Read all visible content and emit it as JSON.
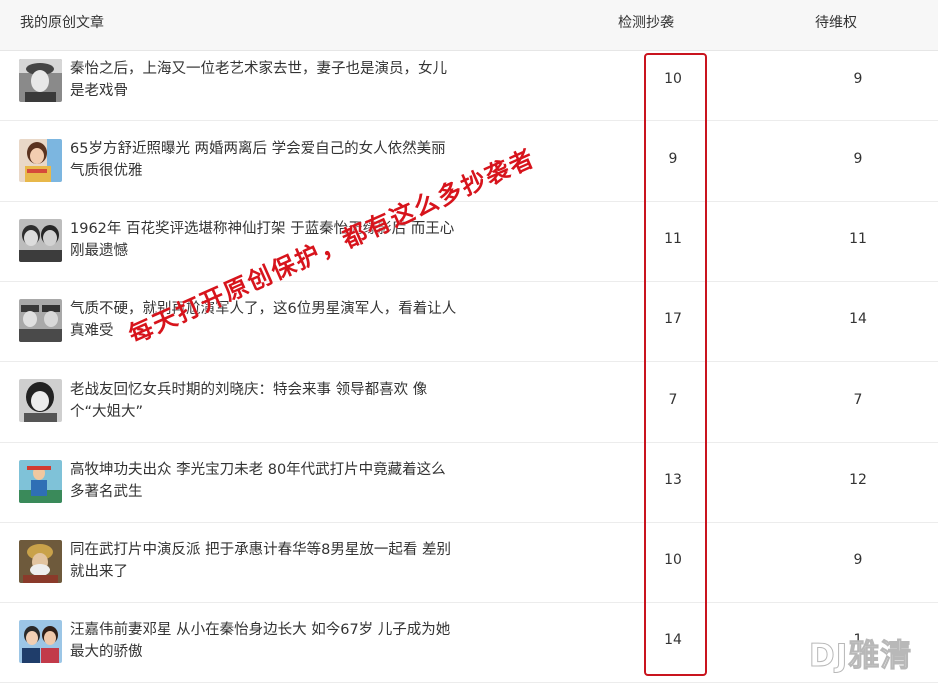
{
  "header": {
    "title": "我的原创文章",
    "detect_label": "检测抄袭",
    "pending_label": "待维权"
  },
  "articles": [
    {
      "title": "秦怡之后，上海又一位老艺术家去世，妻子也是演员，女儿是老戏骨",
      "detect": "10",
      "pending": "9"
    },
    {
      "title": "65岁方舒近照曝光 两婚两离后 学会爱自己的女人依然美丽 气质很优雅",
      "detect": "9",
      "pending": "9"
    },
    {
      "title": "1962年 百花奖评选堪称神仙打架 于蓝秦怡无缘影后 而王心刚最遗憾",
      "detect": "11",
      "pending": "11"
    },
    {
      "title": "气质不硬，就别再尬演军人了，这6位男星演军人，看着让人真难受",
      "detect": "17",
      "pending": "14"
    },
    {
      "title": "老战友回忆女兵时期的刘晓庆：特会来事 领导都喜欢 像个“大姐大”",
      "detect": "7",
      "pending": "7"
    },
    {
      "title": "高牧坤功夫出众 李光宝刀未老 80年代武打片中竟藏着这么多著名武生",
      "detect": "13",
      "pending": "12"
    },
    {
      "title": "同在武打片中演反派 把于承惠计春华等8男星放一起看 差别就出来了",
      "detect": "10",
      "pending": "9"
    },
    {
      "title": "汪嘉伟前妻邓星 从小在秦怡身边长大 如今67岁 儿子成为她最大的骄傲",
      "detect": "14",
      "pending": "1"
    }
  ],
  "overlay": {
    "text": "每天打开原创保护，都有这么多抄袭者",
    "color": "#d7141c"
  },
  "watermark": {
    "text": "DJ雅清"
  },
  "colors": {
    "highlight_box": "#c9141e",
    "header_bg": "#f7f7f7"
  }
}
